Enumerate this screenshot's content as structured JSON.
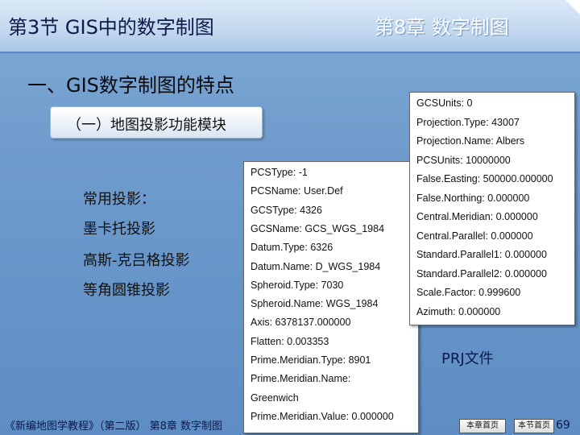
{
  "header": {
    "section_title": "第3节 GIS中的数字制图",
    "chapter_title": "第8章 数字制图"
  },
  "main": {
    "heading": "一、GIS数字制图的特点",
    "banner": "（一）地图投影功能模块",
    "projections": [
      "常用投影：",
      "墨卡托投影",
      "高斯-克吕格投影",
      "等角圆锥投影"
    ]
  },
  "prj_left": [
    "PCSType: -1",
    "PCSName: User.Def",
    "GCSType: 4326",
    "GCSName: GCS_WGS_1984",
    "Datum.Type: 6326",
    "Datum.Name: D_WGS_1984",
    "Spheroid.Type: 7030",
    "Spheroid.Name: WGS_1984",
    "Axis: 6378137.000000",
    "Flatten: 0.003353",
    "Prime.Meridian.Type: 8901",
    "Prime.Meridian.Name:",
    "Greenwich",
    "Prime.Meridian.Value: 0.000000"
  ],
  "prj_right": [
    "GCSUnits: 0",
    "Projection.Type: 43007",
    "Projection.Name: Albers",
    "PCSUnits: 10000000",
    "False.Easting: 500000.000000",
    "False.Northing: 0.000000",
    "Central.Meridian: 0.000000",
    "Central.Parallel: 0.000000",
    "Standard.Parallel1: 0.000000",
    "Standard.Parallel2: 0.000000",
    "Scale.Factor: 0.999600",
    "Azimuth: 0.000000"
  ],
  "prj_file_label": "PRJ文件",
  "footer": {
    "book": "《新编地图学教程》（第二版） 第8章 数字制图",
    "btn_chapter_home": "本章首页",
    "btn_section_home": "本节首页",
    "page": "69"
  },
  "colors": {
    "background": "#6f9ccd",
    "header": "#c3d8ee",
    "title_text": "#0c1a4a"
  }
}
